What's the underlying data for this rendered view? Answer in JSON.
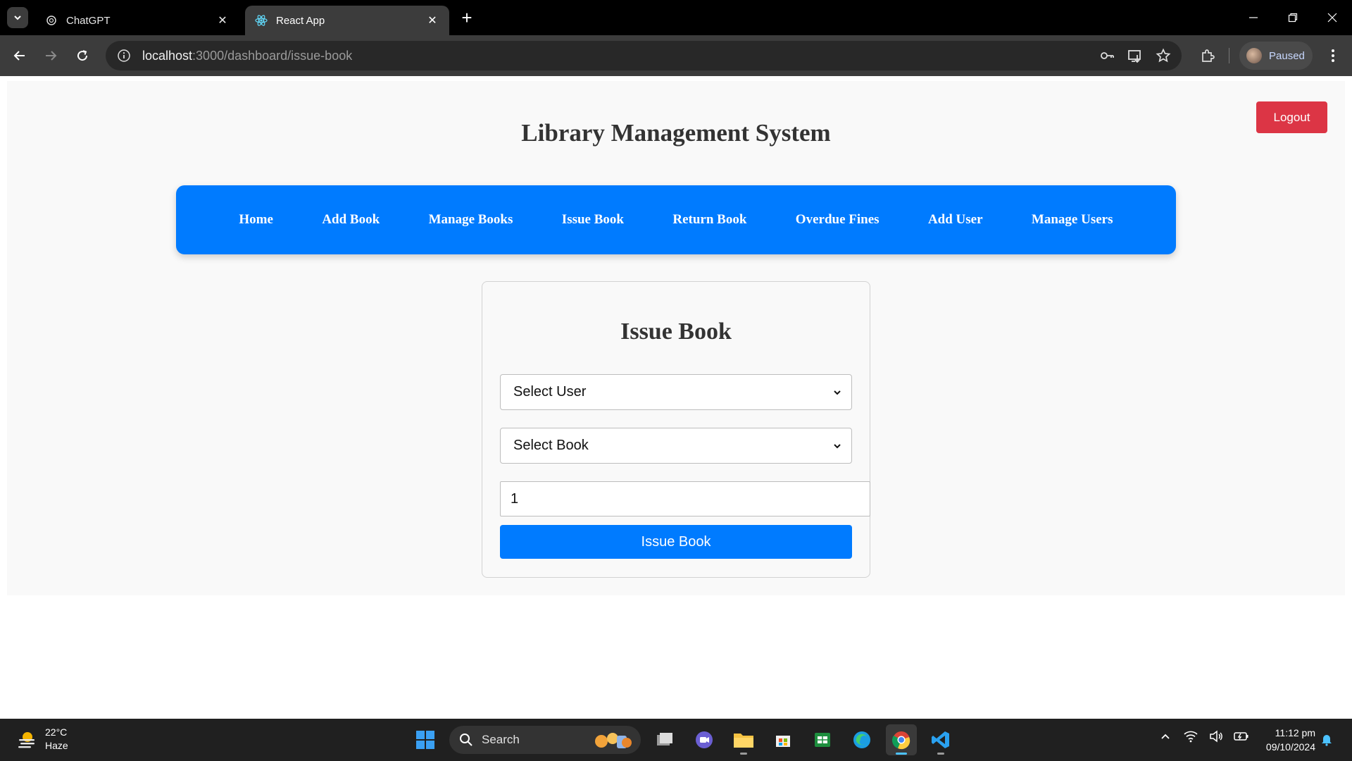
{
  "browser": {
    "tabs": [
      {
        "title": "ChatGPT",
        "active": false
      },
      {
        "title": "React App",
        "active": true
      }
    ],
    "url_host": "localhost",
    "url_path": ":3000/dashboard/issue-book",
    "profile_label": "Paused"
  },
  "app": {
    "logout_label": "Logout",
    "title": "Library Management System",
    "nav": [
      {
        "label": "Home"
      },
      {
        "label": "Add Book"
      },
      {
        "label": "Manage Books"
      },
      {
        "label": "Issue Book"
      },
      {
        "label": "Return Book"
      },
      {
        "label": "Overdue Fines"
      },
      {
        "label": "Add User"
      },
      {
        "label": "Manage Users"
      }
    ],
    "form": {
      "title": "Issue Book",
      "user_select": "Select User",
      "book_select": "Select Book",
      "quantity_value": "1",
      "submit_label": "Issue Book"
    },
    "colors": {
      "primary": "#007bff",
      "danger": "#dc3545",
      "page_bg": "#f9f9f9"
    }
  },
  "taskbar": {
    "weather_temp": "22°C",
    "weather_desc": "Haze",
    "search_label": "Search",
    "time": "11:12 pm",
    "date": "09/10/2024"
  }
}
